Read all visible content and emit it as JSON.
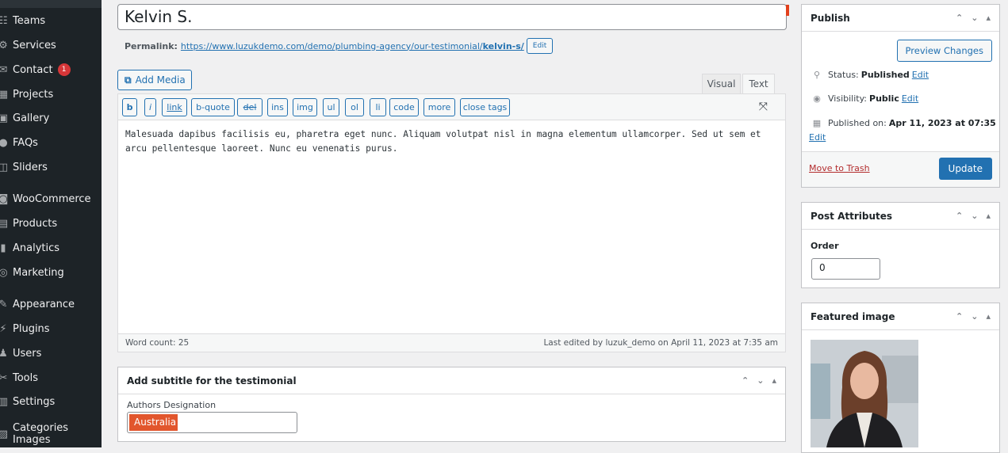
{
  "sidebar": {
    "items": [
      {
        "label": "Teams",
        "icon": "groups-icon",
        "glyph": "☷"
      },
      {
        "label": "Services",
        "icon": "services-icon",
        "glyph": "⚙"
      },
      {
        "label": "Contact",
        "icon": "email-icon",
        "glyph": "✉",
        "badge": "1"
      },
      {
        "label": "Projects",
        "icon": "projects-icon",
        "glyph": "▦"
      },
      {
        "label": "Gallery",
        "icon": "gallery-icon",
        "glyph": "▣"
      },
      {
        "label": "FAQs",
        "icon": "faq-icon",
        "glyph": "●"
      },
      {
        "label": "Sliders",
        "icon": "sliders-icon",
        "glyph": "◫"
      },
      {
        "label": "WooCommerce",
        "icon": "woocommerce-icon",
        "glyph": "◙"
      },
      {
        "label": "Products",
        "icon": "products-icon",
        "glyph": "▤"
      },
      {
        "label": "Analytics",
        "icon": "analytics-icon",
        "glyph": "▮"
      },
      {
        "label": "Marketing",
        "icon": "marketing-icon",
        "glyph": "◎"
      },
      {
        "label": "Appearance",
        "icon": "appearance-icon",
        "glyph": "✎"
      },
      {
        "label": "Plugins",
        "icon": "plugins-icon",
        "glyph": "⚡"
      },
      {
        "label": "Users",
        "icon": "users-icon",
        "glyph": "♟"
      },
      {
        "label": "Tools",
        "icon": "tools-icon",
        "glyph": "✂"
      },
      {
        "label": "Settings",
        "icon": "settings-icon",
        "glyph": "▥"
      },
      {
        "label": "Categories Images",
        "icon": "categories-images-icon",
        "glyph": "▨"
      }
    ]
  },
  "post": {
    "title": "Kelvin S.",
    "permalink_label": "Permalink:",
    "permalink_base": "https://www.luzukdemo.com/demo/plumbing-agency/our-testimonial/",
    "permalink_slug": "kelvin-s/",
    "permalink_edit": "Edit"
  },
  "editor": {
    "add_media": "Add Media",
    "tabs": {
      "visual": "Visual",
      "text": "Text"
    },
    "quicktags": [
      "b",
      "i",
      "link",
      "b-quote",
      "del",
      "ins",
      "img",
      "ul",
      "ol",
      "li",
      "code",
      "more",
      "close tags"
    ],
    "content": "Malesuada dapibus facilisis eu, pharetra eget nunc. Aliquam volutpat nisl in magna elementum ullamcorper. Sed ut sem et arcu pellentesque laoreet. Nunc eu venenatis purus.",
    "word_count": "Word count: 25",
    "last_edited": "Last edited by luzuk_demo on April 11, 2023 at 7:35 am"
  },
  "subtitle_box": {
    "title": "Add subtitle for the testimonial",
    "field_label": "Authors Designation",
    "field_value": "Australia"
  },
  "publish": {
    "title": "Publish",
    "preview": "Preview Changes",
    "status_label": "Status:",
    "status_value": "Published",
    "visibility_label": "Visibility:",
    "visibility_value": "Public",
    "published_label": "Published on:",
    "published_value": "Apr 11, 2023 at 07:35",
    "edit": "Edit",
    "trash": "Move to Trash",
    "update": "Update"
  },
  "attributes": {
    "title": "Post Attributes",
    "order_label": "Order",
    "order_value": "0"
  },
  "featured": {
    "title": "Featured image"
  },
  "colors": {
    "accent": "#2271b1",
    "sidebar_bg": "#1d2327",
    "badge": "#d63638",
    "selection": "#e2562d",
    "trash": "#b32d2e"
  }
}
